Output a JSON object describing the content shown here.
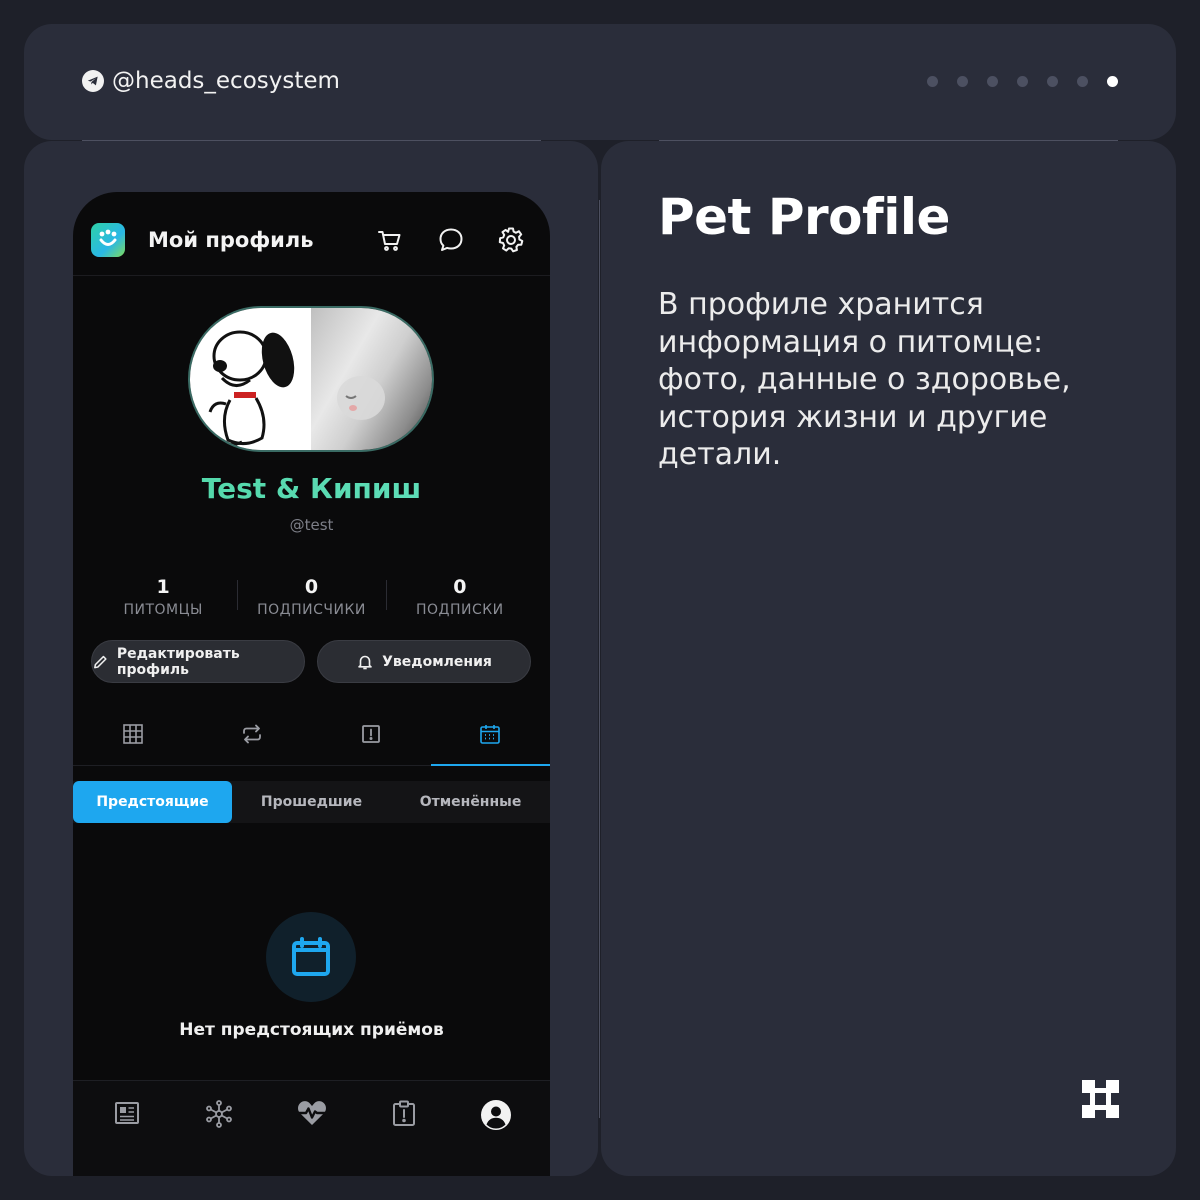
{
  "header": {
    "handle": "@heads_ecosystem",
    "slides_total": 7,
    "slides_active_index": 6
  },
  "app": {
    "title": "Мой профиль",
    "header_icons": [
      "cart-icon",
      "chat-icon",
      "settings-icon"
    ],
    "profile": {
      "name": "Test & Кипиш",
      "handle": "@test"
    },
    "stats": [
      {
        "value": "1",
        "label": "ПИТОМЦЫ"
      },
      {
        "value": "0",
        "label": "ПОДПИСЧИКИ"
      },
      {
        "value": "0",
        "label": "ПОДПИСКИ"
      }
    ],
    "buttons": {
      "edit": "Редактировать профиль",
      "notifications": "Уведомления"
    },
    "tabs": [
      "grid-icon",
      "repost-icon",
      "alert-icon",
      "calendar-icon"
    ],
    "active_tab": 3,
    "segments": [
      "Предстоящие",
      "Прошедшие",
      "Отменённые"
    ],
    "active_segment": 0,
    "empty_state": "Нет предстоящих приёмов",
    "bottom_nav": [
      "news-icon",
      "network-icon",
      "health-icon",
      "clipboard-icon",
      "profile-icon"
    ],
    "accent_color": "#1ea7ef"
  },
  "slide": {
    "title": "Pet Profile",
    "description": "В профиле хранится информация о питомце: фото, данные о здоровье, история жизни и другие детали."
  }
}
